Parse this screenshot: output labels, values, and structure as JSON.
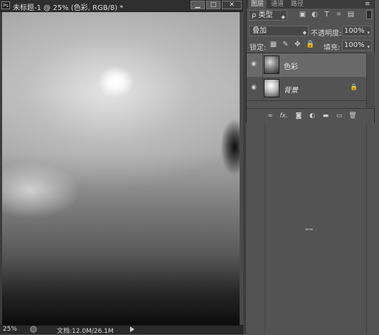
{
  "document": {
    "title": "未标题-1 @ 25% (色彩, RGB/8) *",
    "app_icon": "Ps",
    "window_buttons": {
      "minimize": "▁",
      "maximize": "□",
      "close": "✕"
    }
  },
  "status_bar": {
    "zoom": "25%",
    "doc_info": "文档:12.0M/26.1M"
  },
  "layers_panel": {
    "tabs": [
      "图层",
      "通道",
      "路径"
    ],
    "menu_icon": "≡",
    "collapse_icon": "«",
    "filter": {
      "kind": "ρ 类型",
      "icons": [
        "image-filter-icon",
        "adjustment-filter-icon",
        "type-filter-icon",
        "shape-filter-icon",
        "smart-object-filter-icon"
      ]
    },
    "blend_mode": "叠加",
    "opacity_label": "不透明度:",
    "opacity_value": "100%",
    "lock_label": "锁定:",
    "fill_label": "填充:",
    "fill_value": "100%",
    "layers": [
      {
        "name": "色彩",
        "selected": true,
        "visible": true,
        "locked": false
      },
      {
        "name": "背景",
        "selected": false,
        "visible": true,
        "locked": true
      }
    ],
    "footer_icons": [
      "link-layers-icon",
      "fx-icon",
      "add-mask-icon",
      "adjustment-layer-icon",
      "new-group-icon",
      "new-layer-icon",
      "delete-layer-icon"
    ],
    "footer_fx": "fx."
  },
  "colors": {
    "ui_background": "#535353",
    "title_bar": "#2f2f2f",
    "selected_layer": "#6a6a6a"
  }
}
